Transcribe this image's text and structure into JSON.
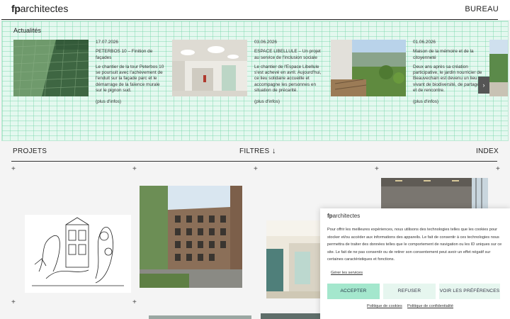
{
  "header": {
    "logo_bold": "fp",
    "logo_rest": "architectes",
    "nav_bureau": "BUREAU"
  },
  "news": {
    "title": "Actualités",
    "items": [
      {
        "date": "17.07.2026",
        "headline": "PETERBOS 10 – Finition de façades",
        "body": "Le chantier de la tour Peterbos 10 se poursuit avec l'achèvement de l'enduit sur la façade parc et le démarrage de la faïence murale sur le pignon sud.",
        "more": "(plus d'infos)"
      },
      {
        "date": "03.06.2026",
        "headline": "ESPACE LIBELLULE – Un projet au service de l'inclusion sociale",
        "body": "Le chantier de l'Espace Libellule s'est achevé en avril. Aujourd'hui, ce lieu solidaire accueille et accompagne les personnes en situation de précarité.",
        "more": "(plus d'infos)"
      },
      {
        "date": "01.06.2026",
        "headline": "Maison de la mémoire et de la citoyenneté",
        "body": "Deux ans après sa création participative, le jardin nourricier de Beauvechain est devenu un lieu vivant de biodiversité, de partage et de rencontre.",
        "more": "(plus d'infos)"
      }
    ],
    "next_arrow": "›"
  },
  "projects_bar": {
    "projets": "PROJETS",
    "filtres": "FILTRES",
    "filtres_arrow": "↓",
    "index": "INDEX"
  },
  "plus_sign": "+",
  "cookie": {
    "logo_bold": "fp",
    "logo_rest": "architectes",
    "text": "Pour offrir les meilleures expériences, nous utilisons des technologies telles que les cookies pour stocker et/ou accéder aux informations des appareils. Le fait de consentir à ces technologies nous permettra de traiter des données telles que le comportement de navigation ou les ID uniques sur ce site. Le fait de ne pas consentir ou de retirer son consentement peut avoir un effet négatif sur certaines caractéristiques et fonctions.",
    "manage": "Gérer les services",
    "accept": "ACCEPTER",
    "refuse": "REFUSER",
    "prefs": "VOIR LES PRÉFÉRENCES",
    "cookie_policy": "Politique de cookies",
    "privacy_policy": "Politique de confidentialité"
  }
}
